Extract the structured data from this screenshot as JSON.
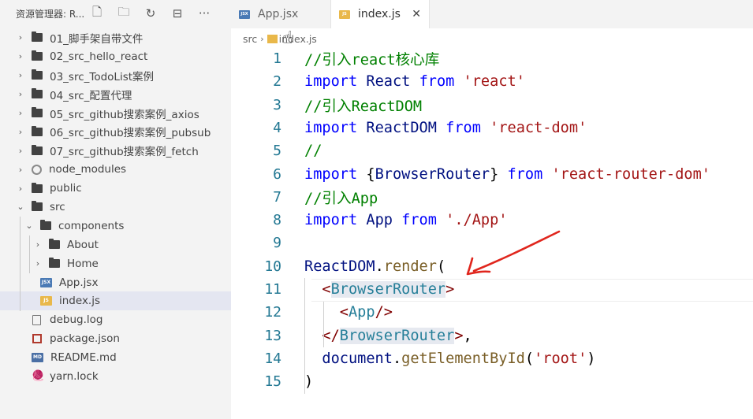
{
  "explorer": {
    "title": "资源管理器: R...",
    "actions": [
      {
        "name": "new-file-icon",
        "glyph": "🗋"
      },
      {
        "name": "new-folder-icon",
        "glyph": "🗀"
      },
      {
        "name": "refresh-icon",
        "glyph": "↻"
      },
      {
        "name": "collapse-all-icon",
        "glyph": "⊟"
      },
      {
        "name": "more-actions-icon",
        "glyph": "···"
      }
    ],
    "items": [
      {
        "label": "01_脚手架自带文件",
        "kind": "folder",
        "chevron": "›",
        "indent": 0
      },
      {
        "label": "02_src_hello_react",
        "kind": "folder",
        "chevron": "›",
        "indent": 0
      },
      {
        "label": "03_src_TodoList案例",
        "kind": "folder",
        "chevron": "›",
        "indent": 0
      },
      {
        "label": "04_src_配置代理",
        "kind": "folder",
        "chevron": "›",
        "indent": 0
      },
      {
        "label": "05_src_github搜索案例_axios",
        "kind": "folder",
        "chevron": "›",
        "indent": 0
      },
      {
        "label": "06_src_github搜索案例_pubsub",
        "kind": "folder",
        "chevron": "›",
        "indent": 0
      },
      {
        "label": "07_src_github搜索案例_fetch",
        "kind": "folder",
        "chevron": "›",
        "indent": 0
      },
      {
        "label": "node_modules",
        "kind": "node_modules",
        "chevron": "›",
        "indent": 0
      },
      {
        "label": "public",
        "kind": "folder",
        "chevron": "›",
        "indent": 0
      },
      {
        "label": "src",
        "kind": "folder",
        "chevron": "⌄",
        "indent": 0
      },
      {
        "label": "components",
        "kind": "folder",
        "chevron": "⌄",
        "indent": 1
      },
      {
        "label": "About",
        "kind": "folder",
        "chevron": "›",
        "indent": 2
      },
      {
        "label": "Home",
        "kind": "folder",
        "chevron": "›",
        "indent": 2
      },
      {
        "label": "App.jsx",
        "kind": "jsx",
        "chevron": "",
        "indent": 1
      },
      {
        "label": "index.js",
        "kind": "js",
        "chevron": "",
        "indent": 1,
        "active": true
      },
      {
        "label": "debug.log",
        "kind": "log",
        "chevron": "",
        "indent": 0
      },
      {
        "label": "package.json",
        "kind": "json",
        "chevron": "",
        "indent": 0
      },
      {
        "label": "README.md",
        "kind": "md",
        "chevron": "",
        "indent": 0
      },
      {
        "label": "yarn.lock",
        "kind": "yarn",
        "chevron": "",
        "indent": 0
      }
    ]
  },
  "tabs": [
    {
      "label": "App.jsx",
      "badge": "JSX",
      "badge_color": "#4a7ab5",
      "active": false
    },
    {
      "label": "index.js",
      "badge": "JS",
      "badge_color": "#e9b84a",
      "active": true,
      "close": "✕"
    }
  ],
  "breadcrumb": {
    "segments": [
      "src",
      "index.js"
    ],
    "separator": "›"
  },
  "editor": {
    "lines": [
      {
        "n": "1",
        "tokens": [
          [
            "cm",
            "//引入react核心库"
          ]
        ]
      },
      {
        "n": "2",
        "tokens": [
          [
            "kw",
            "import"
          ],
          [
            "pn",
            " "
          ],
          [
            "id",
            "React"
          ],
          [
            "pn",
            " "
          ],
          [
            "kw",
            "from"
          ],
          [
            "pn",
            " "
          ],
          [
            "str",
            "'react'"
          ]
        ]
      },
      {
        "n": "3",
        "tokens": [
          [
            "cm",
            "//引入ReactDOM"
          ]
        ]
      },
      {
        "n": "4",
        "tokens": [
          [
            "kw",
            "import"
          ],
          [
            "pn",
            " "
          ],
          [
            "id",
            "ReactDOM"
          ],
          [
            "pn",
            " "
          ],
          [
            "kw",
            "from"
          ],
          [
            "pn",
            " "
          ],
          [
            "str",
            "'react-dom'"
          ]
        ]
      },
      {
        "n": "5",
        "tokens": [
          [
            "cm",
            "//"
          ]
        ]
      },
      {
        "n": "6",
        "tokens": [
          [
            "kw",
            "import"
          ],
          [
            "pn",
            " {"
          ],
          [
            "id",
            "BrowserRouter"
          ],
          [
            "pn",
            "} "
          ],
          [
            "kw",
            "from"
          ],
          [
            "pn",
            " "
          ],
          [
            "str",
            "'react-router-dom'"
          ]
        ]
      },
      {
        "n": "7",
        "tokens": [
          [
            "cm",
            "//引入App"
          ]
        ]
      },
      {
        "n": "8",
        "tokens": [
          [
            "kw",
            "import"
          ],
          [
            "pn",
            " "
          ],
          [
            "id",
            "App"
          ],
          [
            "pn",
            " "
          ],
          [
            "kw",
            "from"
          ],
          [
            "pn",
            " "
          ],
          [
            "str",
            "'./App'"
          ]
        ]
      },
      {
        "n": "9",
        "tokens": []
      },
      {
        "n": "10",
        "tokens": [
          [
            "id",
            "ReactDOM"
          ],
          [
            "pn",
            "."
          ],
          [
            "fn",
            "render"
          ],
          [
            "pn",
            "("
          ]
        ]
      },
      {
        "n": "11",
        "tokens": [
          [
            "pn",
            "  "
          ],
          [
            "tg",
            "<"
          ],
          [
            "tn",
            "BrowserRouter"
          ],
          [
            "tg",
            ">"
          ]
        ]
      },
      {
        "n": "12",
        "tokens": [
          [
            "pn",
            "    "
          ],
          [
            "tg",
            "<"
          ],
          [
            "tn",
            "App"
          ],
          [
            "tg",
            "/>"
          ]
        ]
      },
      {
        "n": "13",
        "tokens": [
          [
            "pn",
            "  "
          ],
          [
            "tg",
            "</"
          ],
          [
            "tn",
            "BrowserRouter"
          ],
          [
            "tg",
            ">"
          ],
          [
            "pn",
            ","
          ]
        ]
      },
      {
        "n": "14",
        "tokens": [
          [
            "pn",
            "  "
          ],
          [
            "id",
            "document"
          ],
          [
            "pn",
            "."
          ],
          [
            "fn",
            "getElementById"
          ],
          [
            "pn",
            "("
          ],
          [
            "str",
            "'root'"
          ],
          [
            "pn",
            ")"
          ]
        ]
      },
      {
        "n": "15",
        "tokens": [
          [
            "pn",
            ")"
          ]
        ]
      }
    ]
  },
  "colors": {
    "keyword": "#0000ff",
    "comment": "#008000",
    "string": "#a31515",
    "identifier": "#001080",
    "function": "#795e26",
    "tag_bracket": "#800000",
    "tag_name": "#267f99",
    "line_number": "#237893",
    "annotation": "#e0261d"
  }
}
